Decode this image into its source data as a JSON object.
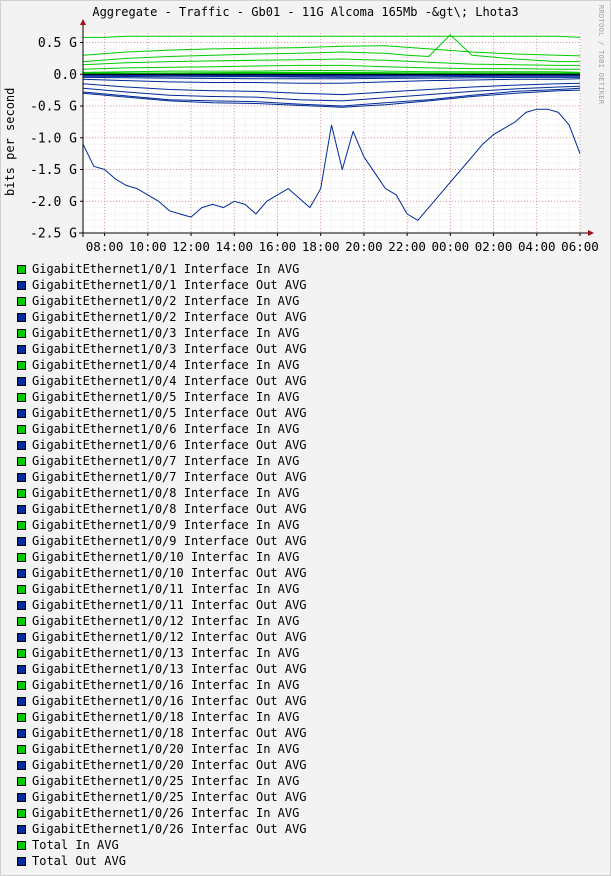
{
  "watermark": "RRDTOOL / TOBI OETIKER",
  "colors": {
    "in": "#00CC00",
    "out": "#002A97",
    "background": "#F3F3F3",
    "plot_area": "#FFFFFF",
    "grid": "#E0A0A0",
    "arrow": "#A01010"
  },
  "chart_data": {
    "type": "line",
    "title": "Aggregate - Traffic - Gb01 - 11G Alcoma 165Mb -&gt\\; Lhota3",
    "ylabel": "bits per second",
    "xlabel": "",
    "ylim": [
      -2.5,
      0.65
    ],
    "y_ticks": [
      {
        "value": 0.5,
        "label": "0.5 G"
      },
      {
        "value": 0.0,
        "label": "0.0"
      },
      {
        "value": -0.5,
        "label": "-0.5 G"
      },
      {
        "value": -1.0,
        "label": "-1.0 G"
      },
      {
        "value": -1.5,
        "label": "-1.5 G"
      },
      {
        "value": -2.0,
        "label": "-2.0 G"
      },
      {
        "value": -2.5,
        "label": "-2.5 G"
      }
    ],
    "x_range_hours": [
      7.0,
      30.0
    ],
    "x_ticks": [
      {
        "hour": 8,
        "label": "08:00"
      },
      {
        "hour": 10,
        "label": "10:00"
      },
      {
        "hour": 12,
        "label": "12:00"
      },
      {
        "hour": 14,
        "label": "14:00"
      },
      {
        "hour": 16,
        "label": "16:00"
      },
      {
        "hour": 18,
        "label": "18:00"
      },
      {
        "hour": 20,
        "label": "20:00"
      },
      {
        "hour": 22,
        "label": "22:00"
      },
      {
        "hour": 24,
        "label": "00:00"
      },
      {
        "hour": 26,
        "label": "02:00"
      },
      {
        "hour": 28,
        "label": "04:00"
      },
      {
        "hour": 30,
        "label": "06:00"
      }
    ],
    "grid": true,
    "legend_position": "bottom",
    "series": [
      {
        "name": "GigabitEthernet1/0/1 Interface In AVG",
        "kind": "in",
        "x": [
          7.0,
          11.0,
          15.0,
          19.0,
          23.0,
          27.0,
          30.0
        ],
        "y": [
          0.0,
          0.0,
          0.0,
          0.0,
          0.0,
          0.0,
          0.0
        ]
      },
      {
        "name": "GigabitEthernet1/0/1 Interface Out AVG",
        "kind": "out",
        "x": [
          7.0,
          11.0,
          15.0,
          19.0,
          23.0,
          27.0,
          30.0
        ],
        "y": [
          -0.01,
          -0.01,
          -0.01,
          -0.01,
          -0.01,
          -0.01,
          -0.01
        ]
      },
      {
        "name": "GigabitEthernet1/0/2 Interface In AVG",
        "kind": "in",
        "x": [
          7.0,
          9.0,
          11.0,
          13.0,
          15.0,
          17.0,
          19.0,
          21.0,
          23.0,
          25.0,
          27.0,
          29.0,
          30.0
        ],
        "y": [
          0.03,
          0.04,
          0.05,
          0.05,
          0.05,
          0.06,
          0.06,
          0.05,
          0.04,
          0.04,
          0.04,
          0.04,
          0.03
        ]
      },
      {
        "name": "GigabitEthernet1/0/2 Interface Out AVG",
        "kind": "out",
        "x": [
          7.0,
          9.0,
          11.0,
          13.0,
          15.0,
          17.0,
          19.0,
          21.0,
          23.0,
          25.0,
          27.0,
          29.0,
          30.0
        ],
        "y": [
          -0.08,
          -0.1,
          -0.12,
          -0.13,
          -0.13,
          -0.14,
          -0.14,
          -0.12,
          -0.1,
          -0.09,
          -0.08,
          -0.08,
          -0.07
        ]
      },
      {
        "name": "GigabitEthernet1/0/3 Interface In AVG",
        "kind": "in",
        "x": [
          7.0,
          9.0,
          11.0,
          13.0,
          15.0,
          17.0,
          19.0,
          21.0,
          23.0,
          25.0,
          27.0,
          29.0,
          30.0
        ],
        "y": [
          0.08,
          0.1,
          0.11,
          0.12,
          0.13,
          0.14,
          0.14,
          0.12,
          0.1,
          0.09,
          0.09,
          0.08,
          0.08
        ]
      },
      {
        "name": "GigabitEthernet1/0/3 Interface Out AVG",
        "kind": "out",
        "x": [
          7.0,
          9.0,
          11.0,
          13.0,
          15.0,
          17.0,
          19.0,
          21.0,
          23.0,
          25.0,
          27.0,
          29.0,
          30.0
        ],
        "y": [
          -0.15,
          -0.2,
          -0.24,
          -0.26,
          -0.27,
          -0.3,
          -0.32,
          -0.28,
          -0.24,
          -0.2,
          -0.17,
          -0.15,
          -0.14
        ]
      },
      {
        "name": "GigabitEthernet1/0/4 Interface In AVG",
        "kind": "in",
        "x": [
          7.0,
          9.0,
          11.0,
          13.0,
          15.0,
          17.0,
          19.0,
          21.0,
          23.0,
          25.0,
          27.0,
          29.0,
          30.0
        ],
        "y": [
          0.15,
          0.18,
          0.2,
          0.21,
          0.22,
          0.23,
          0.24,
          0.22,
          0.19,
          0.16,
          0.15,
          0.14,
          0.14
        ]
      },
      {
        "name": "GigabitEthernet1/0/4 Interface Out AVG",
        "kind": "out",
        "x": [
          7.0,
          9.0,
          11.0,
          13.0,
          15.0,
          17.0,
          19.0,
          21.0,
          23.0,
          25.0,
          27.0,
          29.0,
          30.0
        ],
        "y": [
          -0.22,
          -0.28,
          -0.33,
          -0.35,
          -0.36,
          -0.4,
          -0.42,
          -0.37,
          -0.32,
          -0.27,
          -0.23,
          -0.2,
          -0.19
        ]
      },
      {
        "name": "GigabitEthernet1/0/5 Interface In AVG",
        "kind": "in",
        "x": [
          7.0,
          9.0,
          11.0,
          13.0,
          15.0,
          17.0,
          19.0,
          21.0,
          22.0,
          23.0,
          24.0,
          25.0,
          27.0,
          29.0,
          30.0
        ],
        "y": [
          0.2,
          0.25,
          0.28,
          0.3,
          0.32,
          0.33,
          0.35,
          0.33,
          0.3,
          0.28,
          0.62,
          0.3,
          0.24,
          0.2,
          0.2
        ]
      },
      {
        "name": "GigabitEthernet1/0/5 Interface Out AVG",
        "kind": "out",
        "x": [
          7.0,
          9.0,
          11.0,
          13.0,
          15.0,
          17.0,
          19.0,
          21.0,
          23.0,
          25.0,
          27.0,
          29.0,
          30.0
        ],
        "y": [
          -0.28,
          -0.34,
          -0.4,
          -0.42,
          -0.43,
          -0.47,
          -0.5,
          -0.45,
          -0.4,
          -0.33,
          -0.27,
          -0.24,
          -0.22
        ]
      },
      {
        "name": "GigabitEthernet1/0/6 Interface In AVG",
        "kind": "in",
        "x": [
          7.0,
          9.0,
          11.0,
          13.0,
          15.0,
          17.0,
          19.0,
          21.0,
          23.0,
          25.0,
          27.0,
          29.0,
          30.0
        ],
        "y": [
          0.3,
          0.35,
          0.38,
          0.4,
          0.41,
          0.42,
          0.44,
          0.45,
          0.4,
          0.35,
          0.32,
          0.3,
          0.29
        ]
      },
      {
        "name": "GigabitEthernet1/0/6 Interface Out AVG",
        "kind": "out",
        "x": [
          7.0,
          9.0,
          11.0,
          13.0,
          15.0,
          17.0,
          19.0,
          21.0,
          23.0,
          25.0,
          27.0,
          29.0,
          30.0
        ],
        "y": [
          -0.3,
          -0.36,
          -0.42,
          -0.45,
          -0.46,
          -0.49,
          -0.52,
          -0.48,
          -0.42,
          -0.35,
          -0.3,
          -0.26,
          -0.25
        ]
      },
      {
        "name": "GigabitEthernet1/0/7 Interface In AVG",
        "kind": "in",
        "x": [
          7.0,
          11.0,
          15.0,
          19.0,
          23.0,
          27.0,
          30.0
        ],
        "y": [
          0.01,
          0.01,
          0.02,
          0.02,
          0.01,
          0.01,
          0.01
        ]
      },
      {
        "name": "GigabitEthernet1/0/7 Interface Out AVG",
        "kind": "out",
        "x": [
          7.0,
          11.0,
          15.0,
          19.0,
          23.0,
          27.0,
          30.0
        ],
        "y": [
          -0.03,
          -0.04,
          -0.04,
          -0.05,
          -0.04,
          -0.03,
          -0.03
        ]
      },
      {
        "name": "GigabitEthernet1/0/8 Interface In AVG",
        "kind": "in",
        "x": [
          7.0,
          11.0,
          15.0,
          19.0,
          23.0,
          27.0,
          30.0
        ],
        "y": [
          0.02,
          0.02,
          0.03,
          0.03,
          0.02,
          0.02,
          0.02
        ]
      },
      {
        "name": "GigabitEthernet1/0/8 Interface Out AVG",
        "kind": "out",
        "x": [
          7.0,
          11.0,
          15.0,
          19.0,
          23.0,
          27.0,
          30.0
        ],
        "y": [
          -0.05,
          -0.06,
          -0.07,
          -0.07,
          -0.06,
          -0.05,
          -0.05
        ]
      },
      {
        "name": "GigabitEthernet1/0/9 Interface In AVG",
        "kind": "in",
        "x": [
          7.0,
          11.0,
          15.0,
          19.0,
          23.0,
          27.0,
          30.0
        ],
        "y": [
          0.01,
          0.01,
          0.01,
          0.01,
          0.01,
          0.01,
          0.01
        ]
      },
      {
        "name": "GigabitEthernet1/0/9 Interface Out AVG",
        "kind": "out",
        "x": [
          7.0,
          11.0,
          15.0,
          19.0,
          23.0,
          27.0,
          30.0
        ],
        "y": [
          -0.02,
          -0.02,
          -0.02,
          -0.02,
          -0.02,
          -0.02,
          -0.02
        ]
      },
      {
        "name": "GigabitEthernet1/0/10 Interfac In AVG",
        "kind": "in",
        "x": [
          7.0,
          11.0,
          15.0,
          19.0,
          23.0,
          27.0,
          30.0
        ],
        "y": [
          0.0,
          0.0,
          0.0,
          0.0,
          0.0,
          0.0,
          0.0
        ]
      },
      {
        "name": "GigabitEthernet1/0/10 Interfac Out AVG",
        "kind": "out",
        "x": [
          7.0,
          11.0,
          15.0,
          19.0,
          23.0,
          27.0,
          30.0
        ],
        "y": [
          -0.01,
          -0.01,
          -0.01,
          -0.01,
          -0.01,
          -0.01,
          -0.01
        ]
      },
      {
        "name": "GigabitEthernet1/0/11 Interfac In AVG",
        "kind": "in",
        "x": [
          7.0,
          11.0,
          15.0,
          19.0,
          23.0,
          27.0,
          30.0
        ],
        "y": [
          0.0,
          0.0,
          0.0,
          0.0,
          0.0,
          0.0,
          0.0
        ]
      },
      {
        "name": "GigabitEthernet1/0/11 Interfac Out AVG",
        "kind": "out",
        "x": [
          7.0,
          11.0,
          15.0,
          19.0,
          23.0,
          27.0,
          30.0
        ],
        "y": [
          -0.01,
          -0.01,
          -0.01,
          -0.01,
          -0.01,
          -0.01,
          -0.01
        ]
      },
      {
        "name": "GigabitEthernet1/0/12 Interfac In AVG",
        "kind": "in",
        "x": [
          7.0,
          11.0,
          15.0,
          19.0,
          23.0,
          27.0,
          30.0
        ],
        "y": [
          0.0,
          0.0,
          0.0,
          0.0,
          0.0,
          0.0,
          0.0
        ]
      },
      {
        "name": "GigabitEthernet1/0/12 Interfac Out AVG",
        "kind": "out",
        "x": [
          7.0,
          11.0,
          15.0,
          19.0,
          23.0,
          27.0,
          30.0
        ],
        "y": [
          -0.01,
          -0.01,
          -0.01,
          -0.01,
          -0.01,
          -0.01,
          -0.01
        ]
      },
      {
        "name": "GigabitEthernet1/0/13 Interfac In AVG",
        "kind": "in",
        "x": [
          7.0,
          11.0,
          15.0,
          19.0,
          23.0,
          27.0,
          30.0
        ],
        "y": [
          0.0,
          0.0,
          0.0,
          0.0,
          0.0,
          0.0,
          0.0
        ]
      },
      {
        "name": "GigabitEthernet1/0/13 Interfac Out AVG",
        "kind": "out",
        "x": [
          7.0,
          11.0,
          15.0,
          19.0,
          23.0,
          27.0,
          30.0
        ],
        "y": [
          -0.01,
          -0.01,
          -0.01,
          -0.01,
          -0.01,
          -0.01,
          -0.01
        ]
      },
      {
        "name": "GigabitEthernet1/0/16 Interfac In AVG",
        "kind": "in",
        "x": [
          7.0,
          11.0,
          15.0,
          19.0,
          23.0,
          27.0,
          30.0
        ],
        "y": [
          0.01,
          0.01,
          0.01,
          0.01,
          0.01,
          0.01,
          0.01
        ]
      },
      {
        "name": "GigabitEthernet1/0/16 Interfac Out AVG",
        "kind": "out",
        "x": [
          7.0,
          11.0,
          15.0,
          19.0,
          23.0,
          27.0,
          30.0
        ],
        "y": [
          -0.02,
          -0.02,
          -0.03,
          -0.03,
          -0.02,
          -0.02,
          -0.02
        ]
      },
      {
        "name": "GigabitEthernet1/0/18 Interfac In AVG",
        "kind": "in",
        "x": [
          7.0,
          11.0,
          15.0,
          19.0,
          23.0,
          27.0,
          30.0
        ],
        "y": [
          0.0,
          0.0,
          0.0,
          0.0,
          0.0,
          0.0,
          0.0
        ]
      },
      {
        "name": "GigabitEthernet1/0/18 Interfac Out AVG",
        "kind": "out",
        "x": [
          7.0,
          11.0,
          15.0,
          19.0,
          23.0,
          27.0,
          30.0
        ],
        "y": [
          -0.01,
          -0.01,
          -0.01,
          -0.01,
          -0.01,
          -0.01,
          -0.01
        ]
      },
      {
        "name": "GigabitEthernet1/0/20 Interfac In AVG",
        "kind": "in",
        "x": [
          7.0,
          11.0,
          15.0,
          19.0,
          23.0,
          27.0,
          30.0
        ],
        "y": [
          0.0,
          0.0,
          0.0,
          0.0,
          0.0,
          0.0,
          0.0
        ]
      },
      {
        "name": "GigabitEthernet1/0/20 Interfac Out AVG",
        "kind": "out",
        "x": [
          7.0,
          11.0,
          15.0,
          19.0,
          23.0,
          27.0,
          30.0
        ],
        "y": [
          -0.01,
          -0.01,
          -0.01,
          -0.01,
          -0.01,
          -0.01,
          -0.01
        ]
      },
      {
        "name": "GigabitEthernet1/0/25 Interfac In AVG",
        "kind": "in",
        "x": [
          7.0,
          11.0,
          15.0,
          19.0,
          23.0,
          27.0,
          30.0
        ],
        "y": [
          0.0,
          0.0,
          0.0,
          0.0,
          0.0,
          0.0,
          0.0
        ]
      },
      {
        "name": "GigabitEthernet1/0/25 Interfac Out AVG",
        "kind": "out",
        "x": [
          7.0,
          11.0,
          15.0,
          19.0,
          23.0,
          27.0,
          30.0
        ],
        "y": [
          -0.01,
          -0.01,
          -0.01,
          -0.01,
          -0.01,
          -0.01,
          -0.01
        ]
      },
      {
        "name": "GigabitEthernet1/0/26 Interfac In AVG",
        "kind": "in",
        "x": [
          7.0,
          11.0,
          15.0,
          19.0,
          23.0,
          27.0,
          30.0
        ],
        "y": [
          0.0,
          0.0,
          0.0,
          0.0,
          0.0,
          0.0,
          0.0
        ]
      },
      {
        "name": "GigabitEthernet1/0/26 Interfac Out AVG",
        "kind": "out",
        "x": [
          7.0,
          11.0,
          15.0,
          19.0,
          23.0,
          27.0,
          30.0
        ],
        "y": [
          -0.01,
          -0.01,
          -0.01,
          -0.01,
          -0.01,
          -0.01,
          -0.01
        ]
      },
      {
        "name": "Total In AVG",
        "kind": "in",
        "x": [
          7.0,
          8.0,
          9.0,
          10.0,
          11.0,
          12.0,
          13.0,
          14.0,
          15.0,
          16.0,
          17.0,
          18.0,
          19.0,
          20.0,
          21.0,
          22.0,
          23.0,
          24.0,
          25.0,
          26.0,
          27.0,
          28.0,
          29.0,
          30.0
        ],
        "y": [
          0.58,
          0.58,
          0.6,
          0.6,
          0.6,
          0.6,
          0.6,
          0.6,
          0.6,
          0.6,
          0.6,
          0.6,
          0.6,
          0.6,
          0.6,
          0.6,
          0.6,
          0.6,
          0.6,
          0.6,
          0.6,
          0.6,
          0.6,
          0.58
        ]
      },
      {
        "name": "Total Out AVG",
        "kind": "out",
        "x": [
          7.0,
          7.5,
          8.0,
          8.5,
          9.0,
          9.5,
          10.0,
          10.5,
          11.0,
          11.5,
          12.0,
          12.5,
          13.0,
          13.5,
          14.0,
          14.5,
          15.0,
          15.5,
          16.0,
          16.5,
          17.0,
          17.5,
          18.0,
          18.5,
          19.0,
          19.5,
          20.0,
          20.5,
          21.0,
          21.5,
          22.0,
          22.5,
          23.0,
          23.5,
          24.0,
          24.5,
          25.0,
          25.5,
          26.0,
          26.5,
          27.0,
          27.5,
          28.0,
          28.5,
          29.0,
          29.5,
          30.0
        ],
        "y": [
          -1.1,
          -1.45,
          -1.5,
          -1.65,
          -1.75,
          -1.8,
          -1.9,
          -2.0,
          -2.15,
          -2.2,
          -2.25,
          -2.1,
          -2.05,
          -2.1,
          -2.0,
          -2.05,
          -2.2,
          -2.0,
          -1.9,
          -1.8,
          -1.95,
          -2.1,
          -1.8,
          -0.8,
          -1.5,
          -0.9,
          -1.3,
          -1.55,
          -1.8,
          -1.9,
          -2.2,
          -2.3,
          -2.1,
          -1.9,
          -1.7,
          -1.5,
          -1.3,
          -1.1,
          -0.95,
          -0.85,
          -0.75,
          -0.6,
          -0.55,
          -0.55,
          -0.6,
          -0.8,
          -1.25
        ]
      }
    ]
  }
}
